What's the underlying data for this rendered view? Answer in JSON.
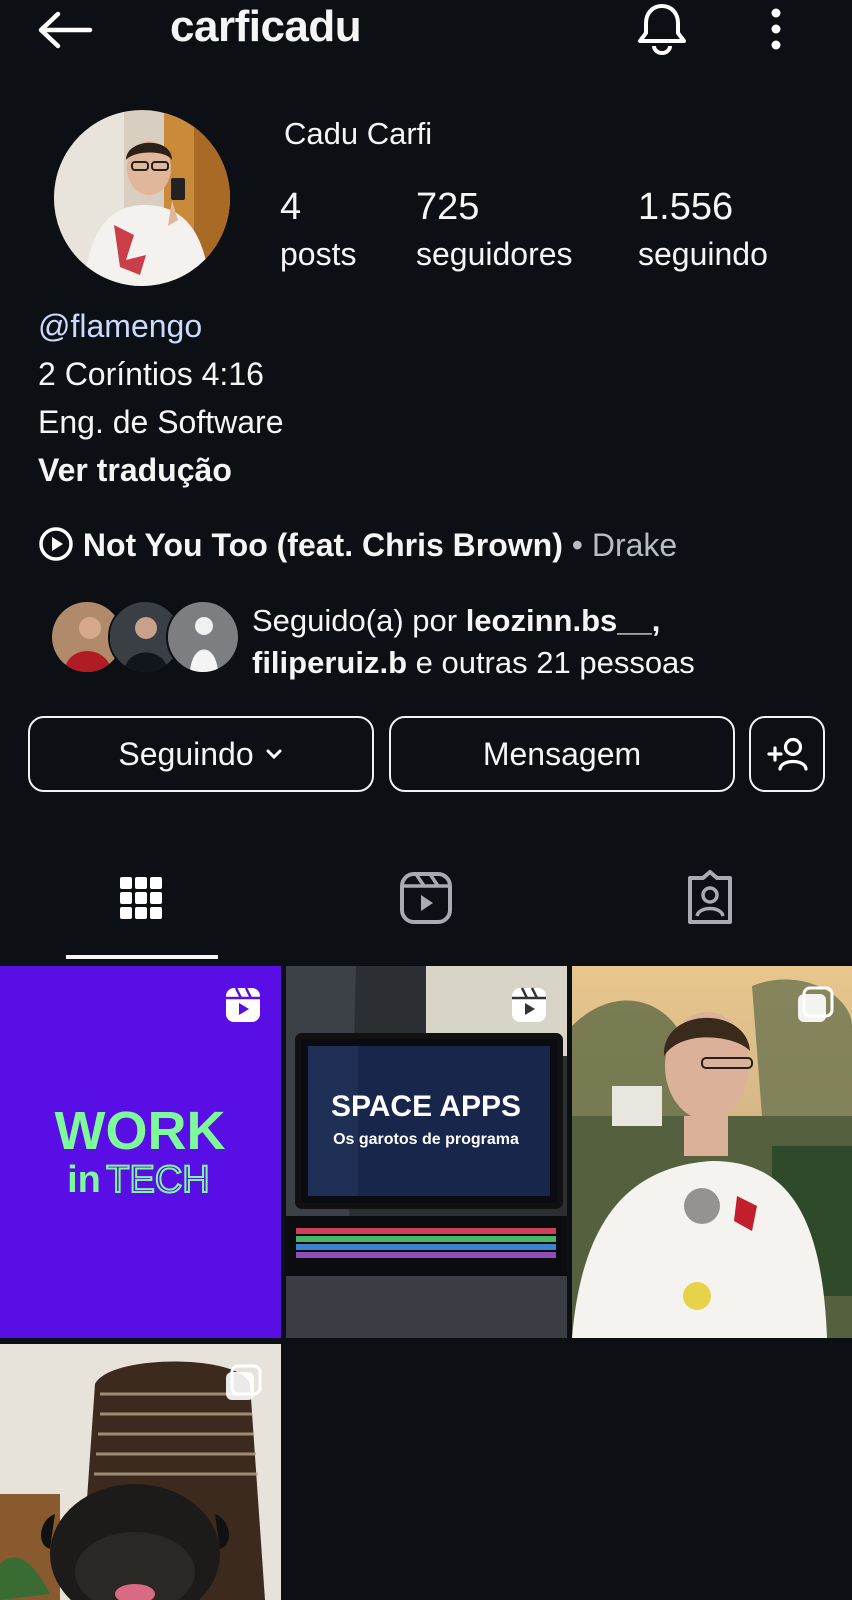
{
  "header": {
    "username": "carficadu",
    "icons": [
      "back-arrow-icon",
      "bell-icon",
      "more-options-icon"
    ]
  },
  "profile": {
    "full_name": "Cadu Carfi",
    "stats": [
      {
        "count": "4",
        "label": "posts"
      },
      {
        "count": "725",
        "label": "seguidores"
      },
      {
        "count": "1.556",
        "label": "seguindo"
      }
    ]
  },
  "bio": {
    "mention": "@flamengo",
    "line1": "2 Coríntios 4:16",
    "line2": "Eng. de Software",
    "translate": "Ver tradução"
  },
  "music": {
    "title": "Not You Too (feat. Chris Brown)",
    "separator": "•",
    "artist": "Drake"
  },
  "followed_by": {
    "prefix": "Seguido(a) por ",
    "user1": "leozinn.bs__",
    "comma": ",",
    "user2": "filiperuiz.b",
    "suffix": " e outras 21 pessoas"
  },
  "actions": {
    "following": "Seguindo",
    "message": "Mensagem"
  },
  "tabs": [
    "grid-icon",
    "reels-icon",
    "tagged-icon"
  ],
  "posts": [
    {
      "type": "reel",
      "line1": "WORK",
      "line2": "in",
      "line3": "TECH"
    },
    {
      "type": "reel",
      "line1": "SPACE APPS",
      "line2": "Os garotos de programa"
    },
    {
      "type": "carousel"
    },
    {
      "type": "carousel"
    }
  ],
  "colors": {
    "background": "#0c0f14",
    "work_tile": "#5a0ee6",
    "work_text": "#7dfa9a",
    "mention": "#c9dcff"
  }
}
